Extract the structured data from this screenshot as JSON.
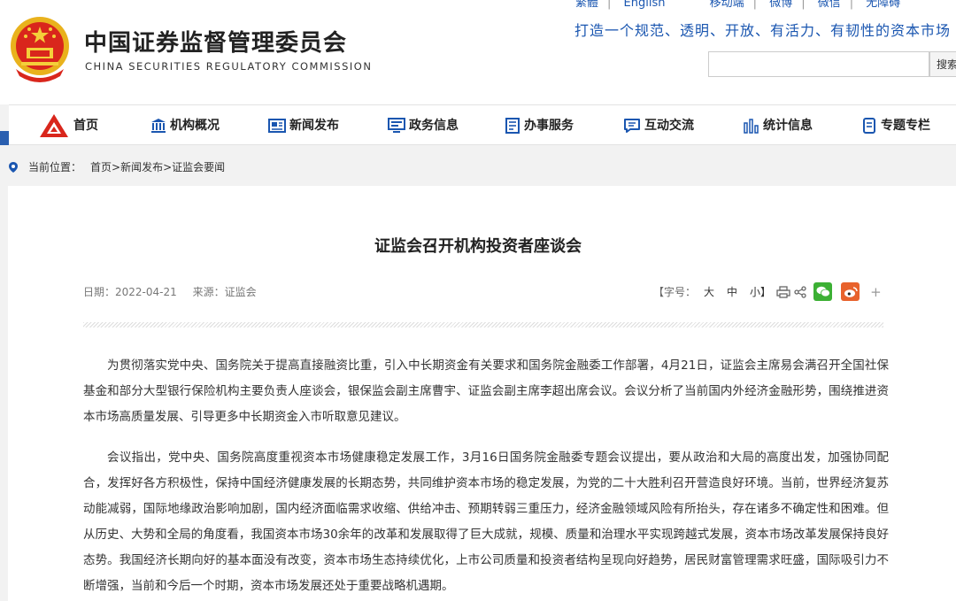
{
  "header": {
    "title_cn": "中国证券监督管理委员会",
    "title_en": "CHINA SECURITIES REGULATORY COMMISSION",
    "emblem_icon": "national-emblem-icon",
    "toplinks": [
      "繁體",
      "English",
      "移动端",
      "微博",
      "微信",
      "无障碍"
    ],
    "slogan": "打造一个规范、透明、开放、有活力、有韧性的资本市场",
    "search_placeholder": "",
    "search_button": "搜索"
  },
  "nav": {
    "items": [
      {
        "label": "首页",
        "icon": "csrc-logo-icon"
      },
      {
        "label": "机构概况",
        "icon": "building-icon"
      },
      {
        "label": "新闻发布",
        "icon": "news-icon"
      },
      {
        "label": "政务信息",
        "icon": "monitor-icon"
      },
      {
        "label": "办事服务",
        "icon": "document-icon"
      },
      {
        "label": "互动交流",
        "icon": "chat-icon"
      },
      {
        "label": "统计信息",
        "icon": "bar-chart-icon"
      },
      {
        "label": "专题专栏",
        "icon": "book-icon"
      }
    ]
  },
  "breadcrumb": {
    "label": "当前位置：",
    "path": "首页>新闻发布>证监会要闻"
  },
  "article": {
    "title": "证监会召开机构投资者座谈会",
    "date_label": "日期：2022-04-21",
    "source_label": "来源：证监会",
    "font_size_label": "【字号：",
    "size_large": "大",
    "size_medium": "中",
    "size_small": "小】",
    "plus": "+",
    "paragraphs": [
      "为贯彻落实党中央、国务院关于提高直接融资比重，引入中长期资金有关要求和国务院金融委工作部署，4月21日，证监会主席易会满召开全国社保基金和部分大型银行保险机构主要负责人座谈会，银保监会副主席曹宇、证监会副主席李超出席会议。会议分析了当前国内外经济金融形势，围绕推进资本市场高质量发展、引导更多中长期资金入市听取意见建议。",
      "会议指出，党中央、国务院高度重视资本市场健康稳定发展工作，3月16日国务院金融委专题会议提出，要从政治和大局的高度出发，加强协同配合，发挥好各方积极性，保持中国经济健康发展的长期态势，共同维护资本市场的稳定发展，为党的二十大胜利召开营造良好环境。当前，世界经济复苏动能减弱，国际地缘政治影响加剧，国内经济面临需求收缩、供给冲击、预期转弱三重压力，经济金融领域风险有所抬头，存在诸多不确定性和困难。但从历史、大势和全局的角度看，我国资本市场30余年的改革和发展取得了巨大成就，规模、质量和治理水平实现跨越式发展，资本市场改革发展保持良好态势。我国经济长期向好的基本面没有改变，资本市场生态持续优化，上市公司质量和投资者结构呈现向好趋势，居民财富管理需求旺盛，国际吸引力不断增强，当前和今后一个时期，资本市场发展还处于重要战略机遇期。"
    ]
  },
  "colors": {
    "brand_blue": "#1a56b0",
    "brand_red": "#d9261c",
    "wechat_green": "#3cb034",
    "weibo_orange": "#e8622c"
  }
}
